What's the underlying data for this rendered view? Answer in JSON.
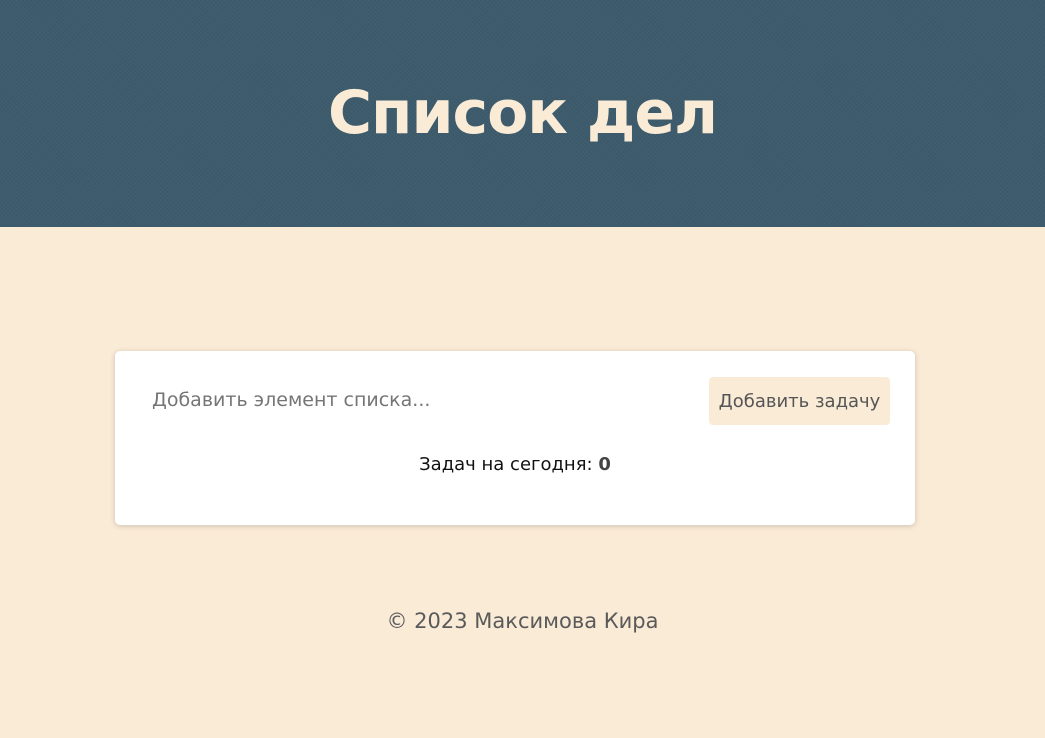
{
  "header": {
    "title": "Список дел",
    "background_color": "#3d5b6c",
    "title_color": "#faebd7"
  },
  "todo": {
    "input_placeholder": "Добавить элемент списка...",
    "input_value": "",
    "add_button_label": "Добавить задачу",
    "counter_label": "Задач на сегодня:",
    "counter_value": "0"
  },
  "footer": {
    "text": "© 2023 Максимова Кира"
  },
  "colors": {
    "page_background": "#faebd7",
    "card_background": "#ffffff",
    "button_background": "#faebd7"
  }
}
